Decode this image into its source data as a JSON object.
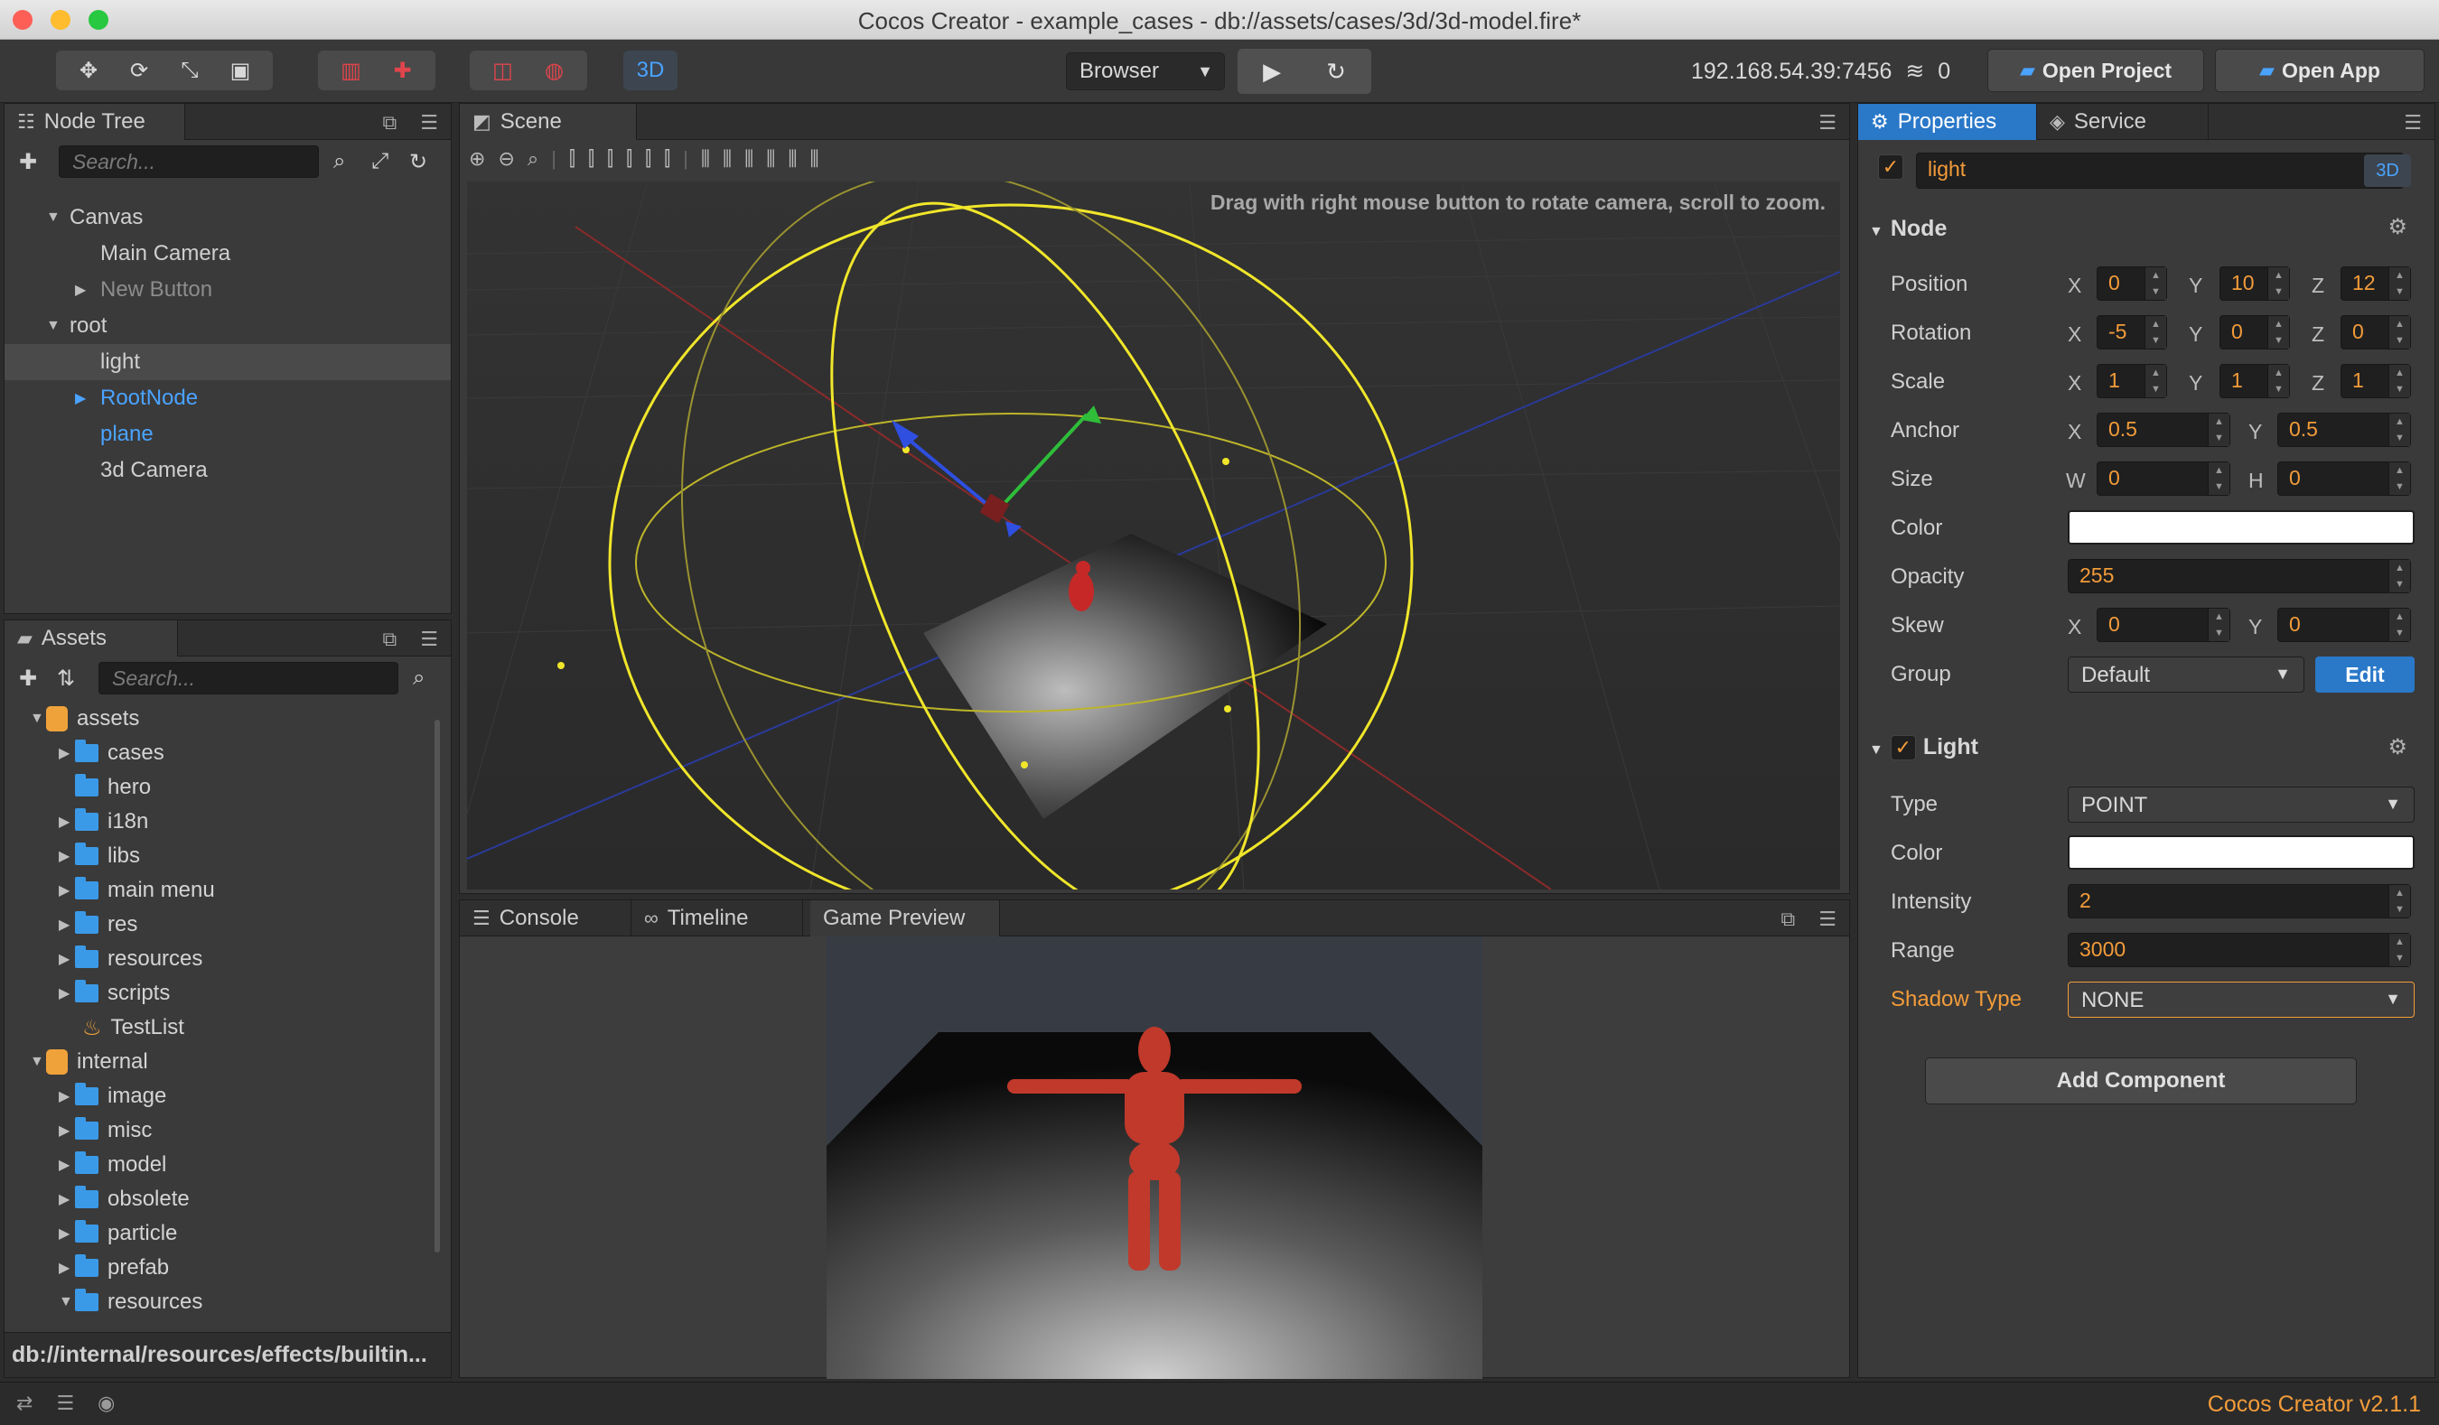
{
  "window": {
    "title": "Cocos Creator - example_cases - db://assets/cases/3d/3d-model.fire*"
  },
  "toolbar": {
    "mode_3d": "3D",
    "platform": "Browser",
    "ip": "192.168.54.39:7456",
    "clients": "0",
    "open_project": "Open Project",
    "open_app": "Open App"
  },
  "node_tree": {
    "tab": "Node Tree",
    "search_placeholder": "Search...",
    "items": [
      {
        "label": "Canvas"
      },
      {
        "label": "Main Camera"
      },
      {
        "label": "New Button"
      },
      {
        "label": "root"
      },
      {
        "label": "light"
      },
      {
        "label": "RootNode"
      },
      {
        "label": "plane"
      },
      {
        "label": "3d Camera"
      }
    ]
  },
  "assets": {
    "tab": "Assets",
    "search_placeholder": "Search...",
    "items": [
      {
        "label": "assets"
      },
      {
        "label": "cases"
      },
      {
        "label": "hero"
      },
      {
        "label": "i18n"
      },
      {
        "label": "libs"
      },
      {
        "label": "main menu"
      },
      {
        "label": "res"
      },
      {
        "label": "resources"
      },
      {
        "label": "scripts"
      },
      {
        "label": "TestList"
      },
      {
        "label": "internal"
      },
      {
        "label": "image"
      },
      {
        "label": "misc"
      },
      {
        "label": "model"
      },
      {
        "label": "obsolete"
      },
      {
        "label": "particle"
      },
      {
        "label": "prefab"
      },
      {
        "label": "resources"
      }
    ],
    "path": "db://internal/resources/effects/builtin..."
  },
  "scene": {
    "tab": "Scene",
    "hint": "Drag with right mouse button to rotate camera, scroll to zoom."
  },
  "bottom_tabs": {
    "console": "Console",
    "timeline": "Timeline",
    "game_preview": "Game Preview"
  },
  "properties": {
    "tab": "Properties",
    "service_tab": "Service",
    "node_name": "light",
    "badge_3d": "3D",
    "node_section": "Node",
    "axes": {
      "x": "X",
      "y": "Y",
      "z": "Z",
      "w": "W",
      "h": "H"
    },
    "labels": {
      "position": "Position",
      "rotation": "Rotation",
      "scale": "Scale",
      "anchor": "Anchor",
      "size": "Size",
      "color": "Color",
      "opacity": "Opacity",
      "skew": "Skew",
      "group": "Group"
    },
    "position": {
      "x": "0",
      "y": "10",
      "z": "12"
    },
    "rotation": {
      "x": "-5",
      "y": "0",
      "z": "0"
    },
    "scale": {
      "x": "1",
      "y": "1",
      "z": "1"
    },
    "anchor": {
      "x": "0.5",
      "y": "0.5"
    },
    "size": {
      "w": "0",
      "h": "0"
    },
    "opacity": "255",
    "skew": {
      "x": "0",
      "y": "0"
    },
    "group": "Default",
    "edit": "Edit",
    "light_section": "Light",
    "light_labels": {
      "type": "Type",
      "color": "Color",
      "intensity": "Intensity",
      "range": "Range",
      "shadow_type": "Shadow Type"
    },
    "light": {
      "type": "POINT",
      "intensity": "2",
      "range": "3000",
      "shadow_type": "NONE"
    },
    "add_component": "Add Component"
  },
  "status": {
    "version": "Cocos Creator v2.1.1"
  },
  "colors": {
    "accent": "#2a78c8",
    "orange": "#f39c3a",
    "link": "#4aa3ff"
  }
}
